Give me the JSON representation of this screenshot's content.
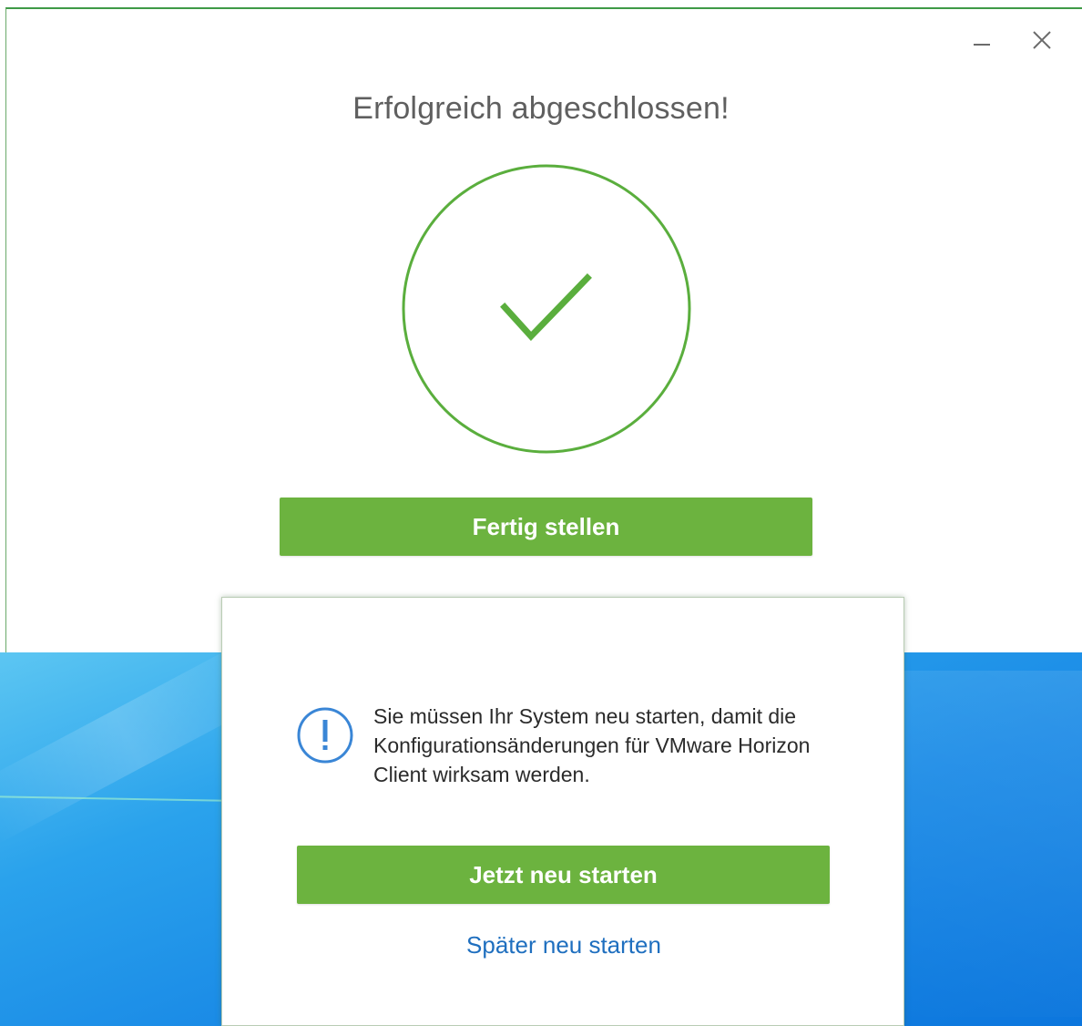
{
  "window": {
    "title": "Erfolgreich abgeschlossen!",
    "finish_button_label": "Fertig stellen"
  },
  "window_controls": {
    "minimize_icon": "minimize-icon",
    "close_icon": "close-icon"
  },
  "status_icon": "checkmark-circle-icon",
  "restart_dialog": {
    "icon": "info-exclamation-icon",
    "message": "Sie müssen Ihr System neu starten, damit die Konfigurationsänderungen für VMware Horizon Client wirksam werden.",
    "restart_now_label": "Jetzt neu starten",
    "restart_later_label": "Später neu starten"
  },
  "colors": {
    "accent_green": "#6cb33f",
    "link_blue": "#1f6fbf",
    "check_green": "#5aae3d",
    "info_blue": "#3a86d6"
  }
}
